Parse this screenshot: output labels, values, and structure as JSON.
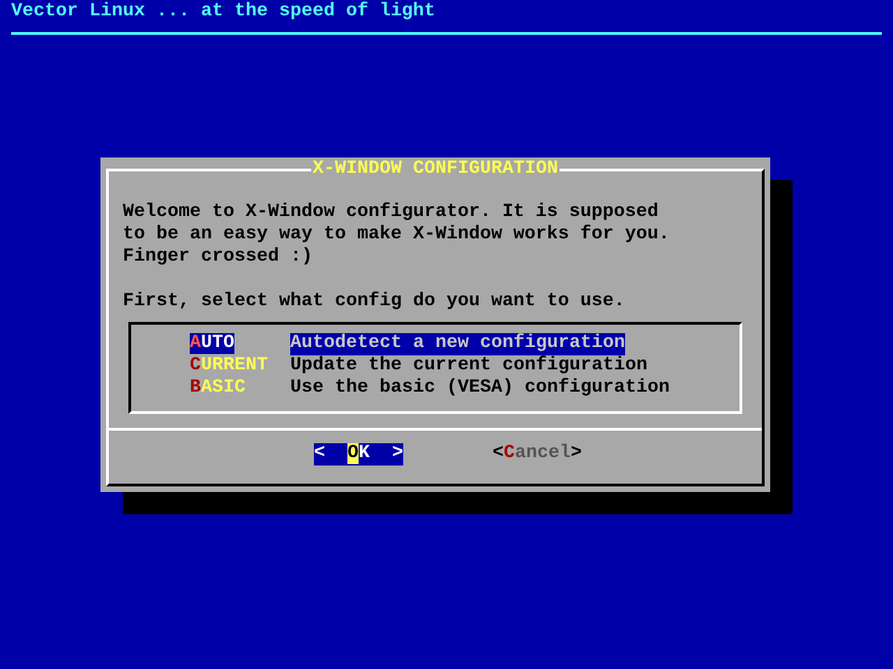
{
  "backtitle": "Vector Linux ... at the speed of light",
  "dialog": {
    "title": "X-WINDOW CONFIGURATION",
    "message": [
      [
        "Welcome to X-Window configurator. It is supposed",
        "to be an easy way to make X-Window works for you.",
        "Finger crossed :)"
      ],
      [
        "First, select what config do you want to use."
      ]
    ],
    "menu": [
      {
        "hotkey": "A",
        "rest": "UTO",
        "description": "Autodetect a new configuration",
        "selected": true
      },
      {
        "hotkey": "C",
        "rest": "URRENT",
        "description": "Update the current configuration",
        "selected": false
      },
      {
        "hotkey": "B",
        "rest": "ASIC",
        "description": "Use the basic (VESA) configuration",
        "selected": false
      }
    ],
    "buttons": [
      {
        "open": "<  ",
        "hotkey": "O",
        "rest": "K  ",
        "close": ">",
        "selected": true
      },
      {
        "open": "<",
        "hotkey": "C",
        "rest": "ancel",
        "close": ">",
        "selected": false
      }
    ]
  }
}
